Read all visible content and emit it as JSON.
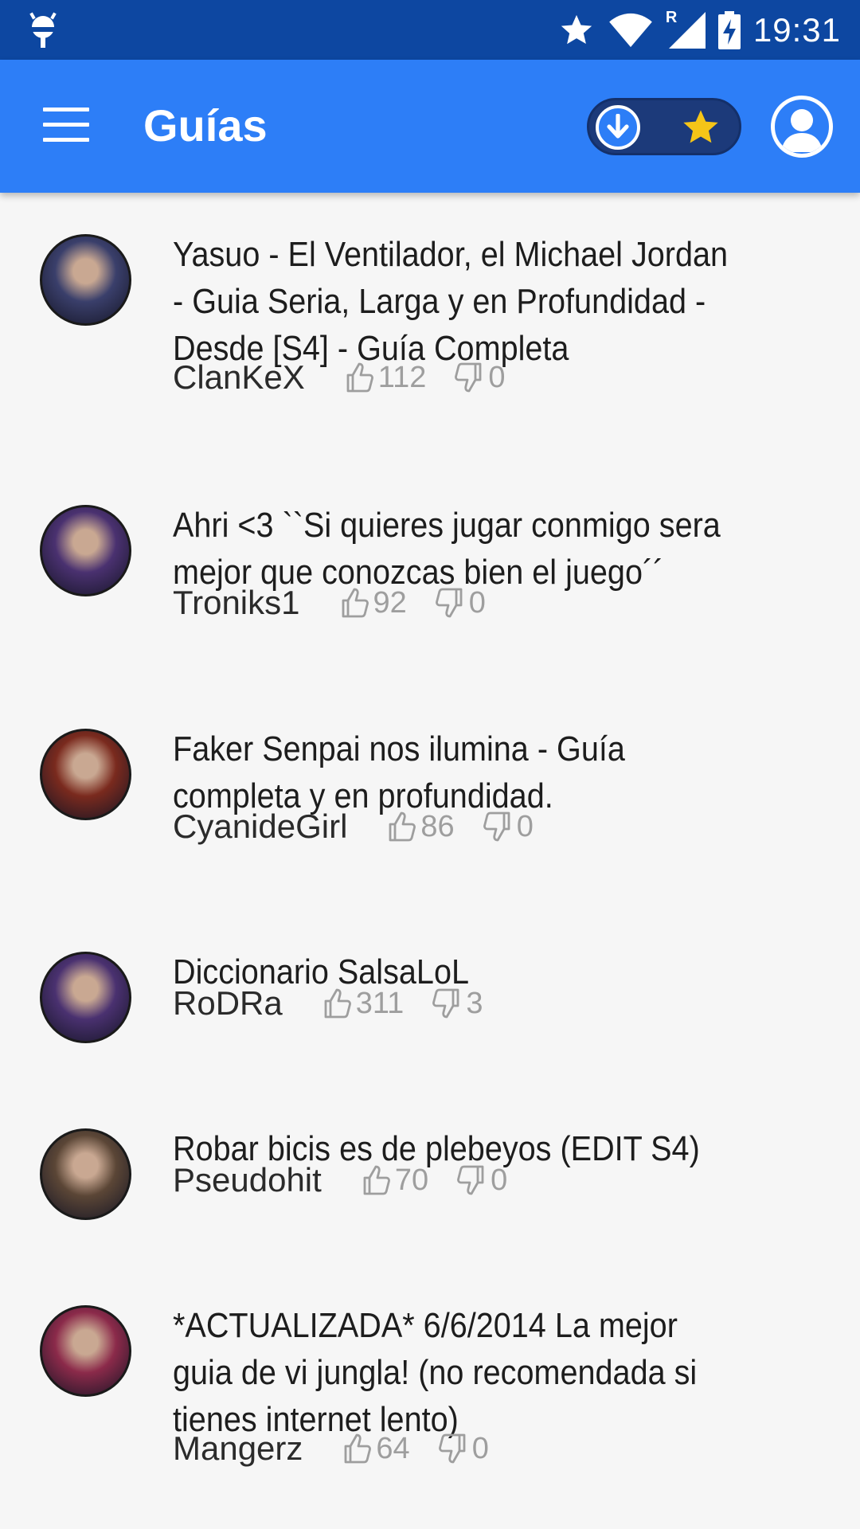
{
  "status_bar": {
    "time": "19:31",
    "roaming": "R"
  },
  "app_bar": {
    "title": "Guías"
  },
  "guides": [
    {
      "title_lines": [
        "Yasuo - El Ventilador, el Michael Jordan",
        "- Guia Seria, Larga y en Profundidad -",
        "Desde [S4] - Guía Completa"
      ],
      "author": "ClanKeX",
      "likes": "112",
      "dislikes": "0",
      "avatar_color": "#3a3f6b"
    },
    {
      "title_lines": [
        "Ahri <3 ``Si quieres jugar conmigo sera",
        "mejor que conozcas bien el juego´´"
      ],
      "author": "Troniks1",
      "likes": "92",
      "dislikes": "0",
      "avatar_color": "#4a3170"
    },
    {
      "title_lines": [
        "Faker Senpai nos ilumina - Guía",
        "completa y en profundidad."
      ],
      "author": "CyanideGirl",
      "likes": "86",
      "dislikes": "0",
      "avatar_color": "#7a2a1e"
    },
    {
      "title_lines": [
        "Diccionario SalsaLoL"
      ],
      "author": "RoDRa",
      "likes": "311",
      "dislikes": "3",
      "avatar_color": "#4a3170"
    },
    {
      "title_lines": [
        "Robar bicis es de plebeyos (EDIT S4)"
      ],
      "author": "Pseudohit",
      "likes": "70",
      "dislikes": "0",
      "avatar_color": "#5b4636"
    },
    {
      "title_lines": [
        "*ACTUALIZADA* 6/6/2014 La mejor",
        "guia de vi jungla! (no recomendada si",
        "tienes internet lento)"
      ],
      "author": "Mangerz",
      "likes": "64",
      "dislikes": "0",
      "avatar_color": "#8b2a4a"
    }
  ],
  "colors": {
    "status_bar": "#0d47a1",
    "app_bar": "#2d7ef7",
    "star": "#f5c518"
  }
}
